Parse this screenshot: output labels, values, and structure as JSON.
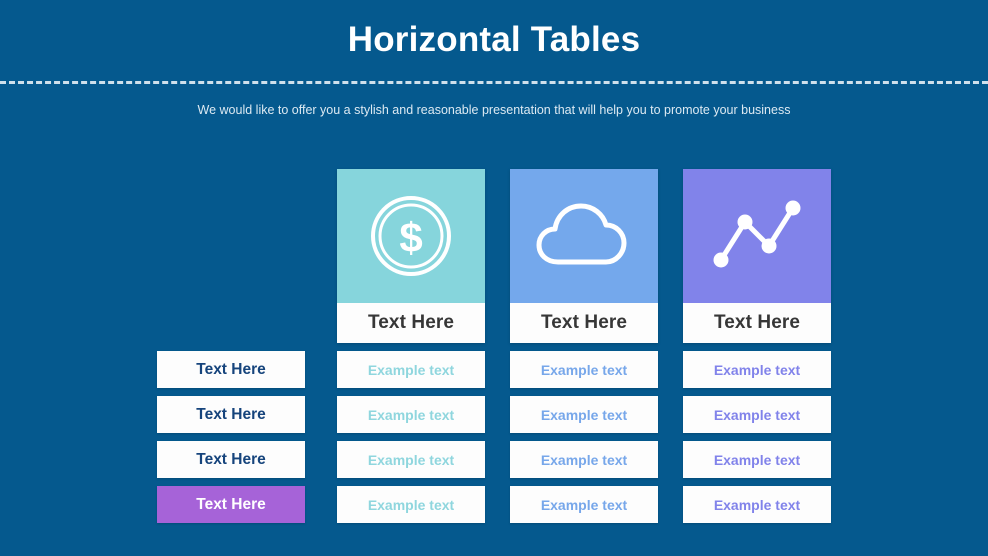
{
  "header": {
    "title": "Horizontal Tables",
    "subtitle": "We would like to offer you a stylish and reasonable presentation that will help you to promote your business"
  },
  "colors": {
    "background": "#05598e",
    "card_teal": "#86d5dc",
    "card_blue": "#74a8ec",
    "card_purple": "#8183ea",
    "highlight_purple": "#a663d8",
    "label_text": "#16447c",
    "header_label_text": "#373737",
    "divider": "#cfe0ec"
  },
  "table": {
    "row_labels": [
      {
        "text": "Text Here",
        "highlighted": false
      },
      {
        "text": "Text Here",
        "highlighted": false
      },
      {
        "text": "Text Here",
        "highlighted": false
      },
      {
        "text": "Text Here",
        "highlighted": true
      }
    ],
    "columns": [
      {
        "icon": "coin-dollar-icon",
        "header": "Text Here",
        "accent": "#86d5dc",
        "cells": [
          "Example text",
          "Example text",
          "Example text",
          "Example text"
        ]
      },
      {
        "icon": "cloud-icon",
        "header": "Text Here",
        "accent": "#74a8ec",
        "cells": [
          "Example text",
          "Example text",
          "Example text",
          "Example text"
        ]
      },
      {
        "icon": "line-chart-icon",
        "header": "Text Here",
        "accent": "#8183ea",
        "cells": [
          "Example text",
          "Example text",
          "Example text",
          "Example text"
        ]
      }
    ]
  }
}
